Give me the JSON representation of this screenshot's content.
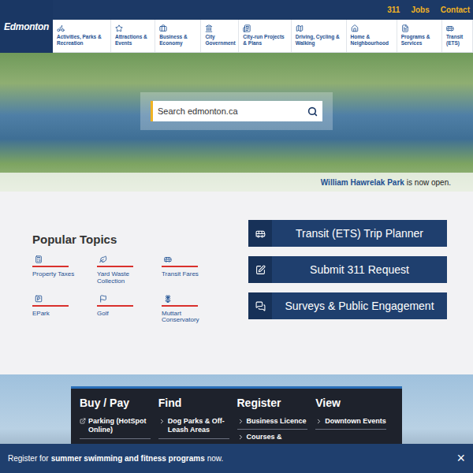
{
  "header": {
    "logo": "Edmonton",
    "utility_links": [
      "311",
      "Jobs",
      "Contact"
    ],
    "nav": [
      "Activities, Parks & Recreation",
      "Attractions & Events",
      "Business & Economy",
      "City Government",
      "City-run Projects & Plans",
      "Driving, Cycling & Walking",
      "Home & Neighbourhood",
      "Programs & Services",
      "Transit (ETS)"
    ]
  },
  "search": {
    "placeholder": "Search edmonton.ca"
  },
  "hero_caption": {
    "link": "William Hawrelak Park",
    "text": "is now open."
  },
  "popular_topics": {
    "title": "Popular Topics",
    "items": [
      "Property Taxes",
      "Yard Waste Collection",
      "Transit Fares",
      "EPark",
      "Golf",
      "Muttart Conservatory"
    ]
  },
  "quick_links": [
    "Transit (ETS) Trip Planner",
    "Submit 311 Request",
    "Surveys & Public Engagement"
  ],
  "tasks": [
    {
      "title": "Buy / Pay",
      "items": [
        {
          "label": "Parking (HotSpot Online)",
          "external": true
        }
      ]
    },
    {
      "title": "Find",
      "items": [
        {
          "label": "Dog Parks & Off-Leash Areas",
          "external": false
        }
      ]
    },
    {
      "title": "Register",
      "items": [
        {
          "label": "Business Licence",
          "external": false
        },
        {
          "label": "Courses &",
          "external": false
        }
      ]
    },
    {
      "title": "View",
      "items": [
        {
          "label": "Downtown Events",
          "external": false
        }
      ]
    }
  ],
  "banner": {
    "parts": [
      {
        "text": "Register for",
        "bold": false
      },
      {
        "text": "summer swimming and fitness programs",
        "bold": true
      },
      {
        "text": "now.",
        "bold": false
      }
    ],
    "close": "×"
  }
}
